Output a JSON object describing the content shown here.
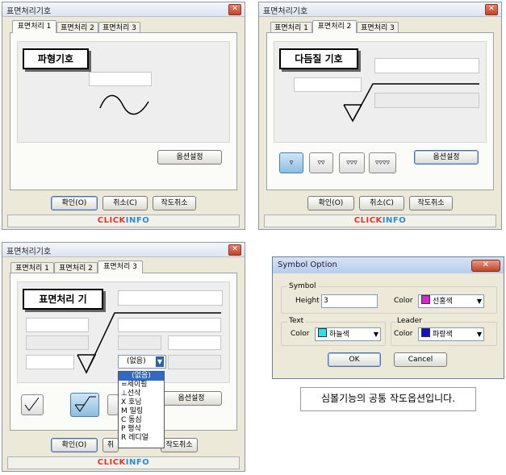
{
  "win1": {
    "title": "표면처리기호",
    "tabs": [
      "표면처리 1",
      "표면처리 2",
      "표면처리 3"
    ],
    "label": "파형기호",
    "option_btn": "옵션설정",
    "ok": "확인(O)",
    "cancel": "취소(C)",
    "draw_cancel": "작도취소",
    "brand_a": "CLICK",
    "brand_b": "INFO"
  },
  "win2": {
    "title": "표면처리기호",
    "tabs": [
      "표면처리 1",
      "표면처리 2",
      "표면처리 3"
    ],
    "label": "다듬질 기호",
    "symbols": [
      "▿",
      "▿▿",
      "▿▿▿",
      "▿▿▿▿"
    ],
    "option_btn": "옵션설정",
    "ok": "확인(O)",
    "cancel": "취소(C)",
    "draw_cancel": "작도취소",
    "brand_a": "CLICK",
    "brand_b": "INFO"
  },
  "win3": {
    "title": "표면처리기호",
    "tabs": [
      "표면처리 1",
      "표면처리 2",
      "표면처리 3"
    ],
    "label": "표면처리 기",
    "combo_value": "(없음)",
    "dropdown": [
      "(없음)",
      "=세이핑",
      "⊥선삭",
      "X 호닝",
      "M 밀링",
      "C 동심",
      "P 평삭",
      "R 레디얼"
    ],
    "option_btn": "옵션설정",
    "ok": "확인(O)",
    "cancel": "취",
    "draw_cancel": "작도취소",
    "brand_a": "CLICK",
    "brand_b": "INFO"
  },
  "symbol_option": {
    "title": "Symbol Option",
    "close": "✕",
    "symbol_group": "Symbol",
    "height_label": "Height",
    "height_value": "3",
    "color_label": "Color",
    "symbol_color_name": "선홍색",
    "symbol_color": "#e020d0",
    "text_group": "Text",
    "text_color_label": "Color",
    "text_color_name": "하늘색",
    "text_color": "#30e0e8",
    "leader_group": "Leader",
    "leader_color_label": "Color",
    "leader_color_name": "파랑색",
    "leader_color": "#1010d0",
    "ok": "OK",
    "cancel": "Cancel"
  },
  "caption": "심볼기능의 공통 작도옵션입니다."
}
